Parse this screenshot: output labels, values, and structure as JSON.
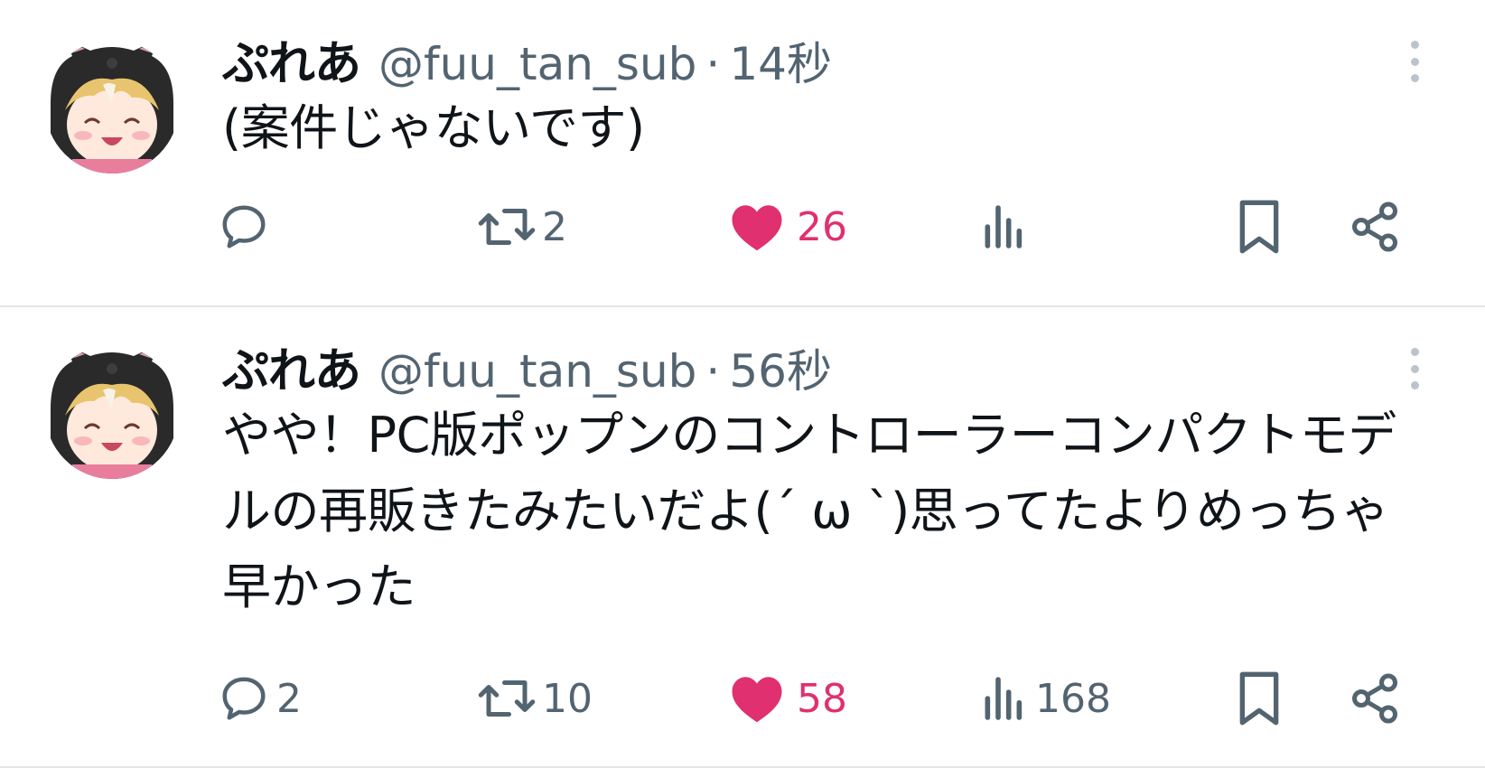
{
  "tweets": [
    {
      "author_name": "ぷれあ",
      "handle": "@fuu_tan_sub",
      "separator": "·",
      "time": "14秒",
      "text": "(案件じゃないです)",
      "replies": "",
      "retweets": "2",
      "likes": "26",
      "views": ""
    },
    {
      "author_name": "ぷれあ",
      "handle": "@fuu_tan_sub",
      "separator": "·",
      "time": "56秒",
      "text": "やや！PC版ポップンのコントローラーコンパクトモデルの再販きたみたいだよ(ˊ ω ˋ)思ってたよりめっちゃ早かった",
      "replies": "2",
      "retweets": "10",
      "likes": "58",
      "views": "168"
    }
  ],
  "icons": {
    "reply": "reply-icon",
    "retweet": "retweet-icon",
    "like": "heart-icon",
    "views": "views-icon",
    "bookmark": "bookmark-icon",
    "share": "share-icon",
    "more": "more-icon"
  },
  "colors": {
    "like": "#e0306f",
    "secondary_text": "#536471",
    "icon": "#536471",
    "divider": "#e3e6e9"
  }
}
